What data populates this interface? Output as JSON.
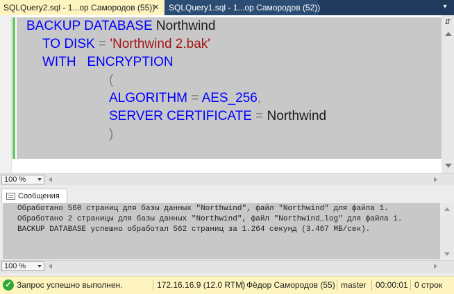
{
  "tabs": {
    "active": {
      "label": "SQLQuery2.sql - 1...ор Самородов (55))",
      "close": "✕"
    },
    "inactive": {
      "label": "SQLQuery1.sql - 1...ор Самородов (52))"
    }
  },
  "editor": {
    "line1": {
      "kw1": "BACKUP DATABASE",
      "name": "Northwind"
    },
    "line2": {
      "kw": "TO DISK",
      "op": "=",
      "str": "'Northwind 2.bak'"
    },
    "line3": {
      "kw": "WITH   ENCRYPTION"
    },
    "line4": {
      "op": "("
    },
    "line5": {
      "kw": "ALGORITHM",
      "op": "=",
      "val": "AES_256",
      "comma": ","
    },
    "line6": {
      "kw": "SERVER CERTIFICATE",
      "op": "=",
      "name": "Northwind"
    },
    "line7": {
      "op": ")"
    }
  },
  "editor_zoom": {
    "value": "100 %"
  },
  "results": {
    "tab_label": "Сообщения",
    "messages": [
      "Обработано 560 страниц для базы данных \"Northwind\", файл \"Northwind\" для файла 1.",
      "Обработано 2 страницы для базы данных \"Northwind\", файл \"Northwind_log\" для файла 1.",
      "BACKUP DATABASE успешно обработал 562 страниц за 1.264 секунд (3.467 МБ/сек)."
    ]
  },
  "results_zoom": {
    "value": "100 %"
  },
  "status": {
    "message": "Запрос успешно выполнен.",
    "server": "172.16.16.9 (12.0 RTM)",
    "user": "Фёдор Самородов (55)",
    "database": "master",
    "elapsed": "00:00:01",
    "rows": "0 строк"
  },
  "colors": {
    "keyword": "#0000ff",
    "string": "#a31515",
    "operator": "#808080",
    "statusbar": "#fdf4bf",
    "tabbar": "#1f3a5c"
  }
}
